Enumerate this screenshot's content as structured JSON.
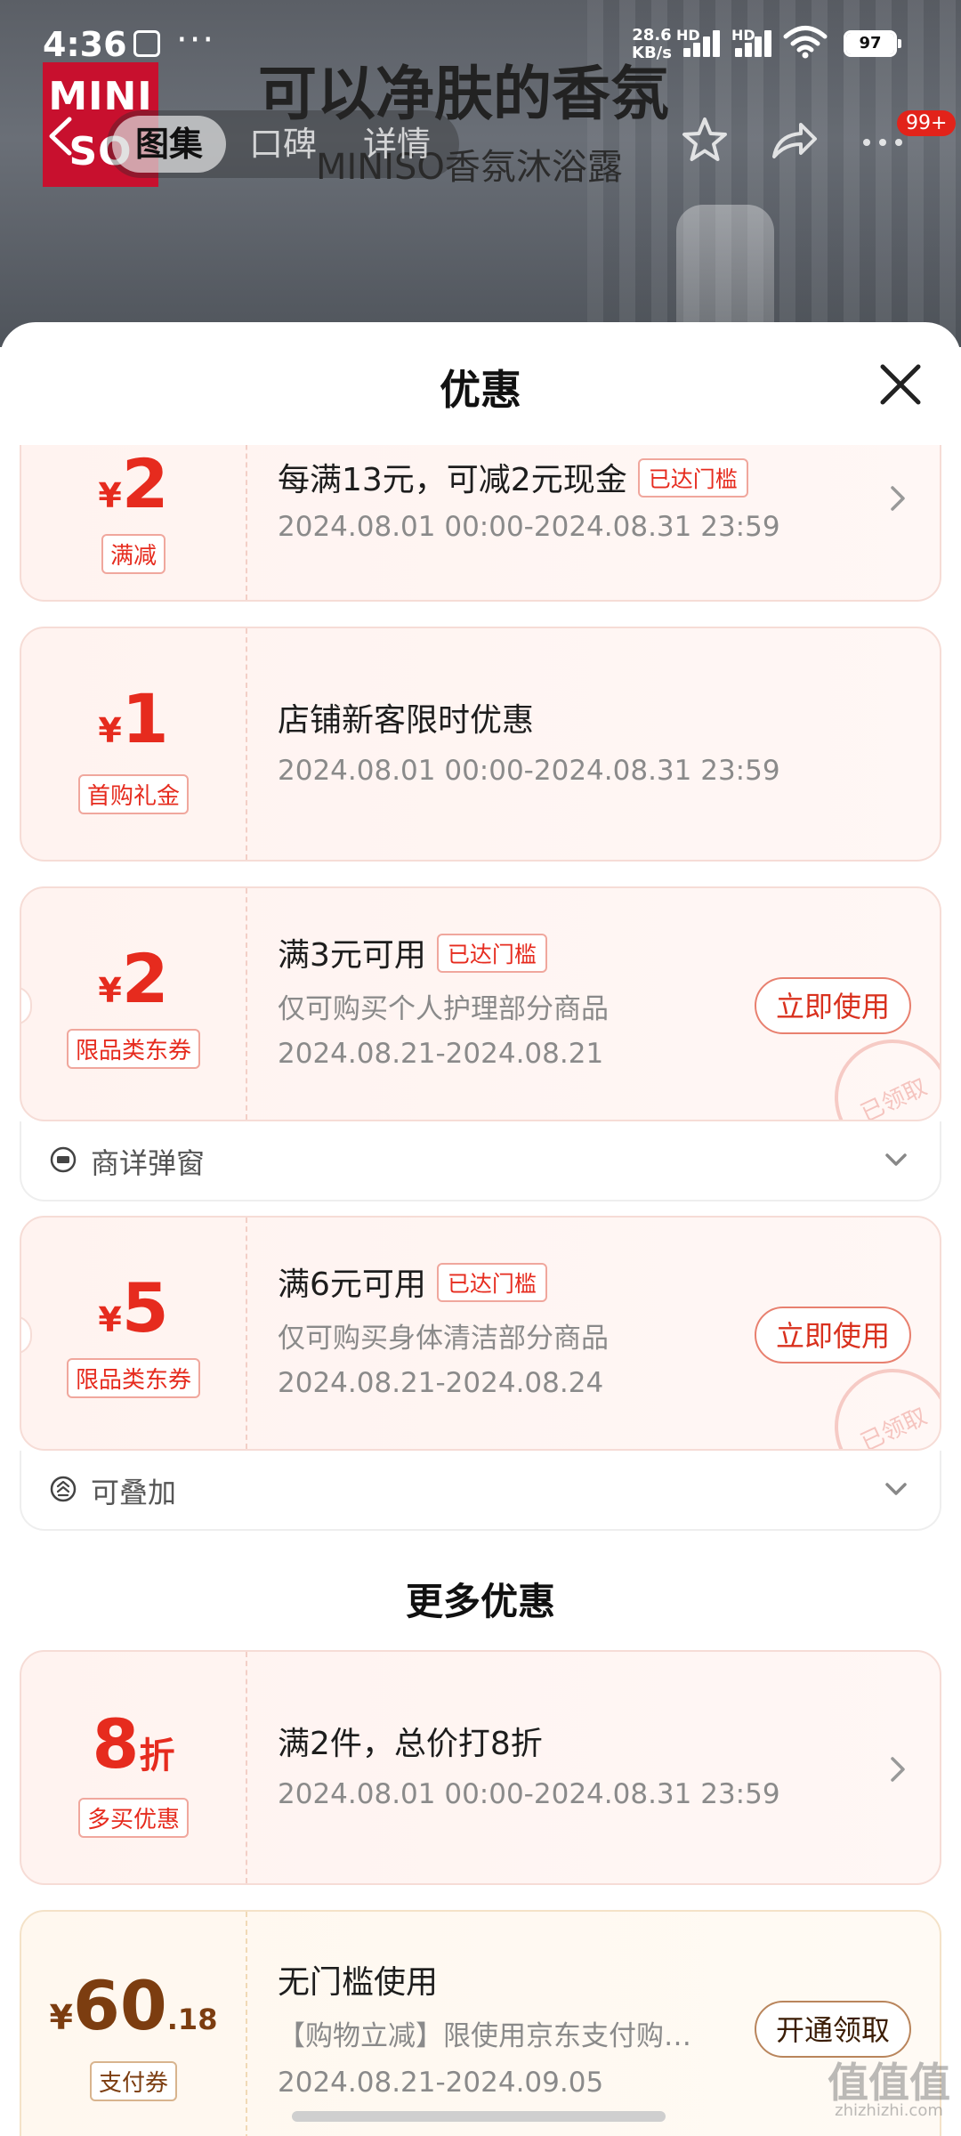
{
  "status_bar": {
    "time": "4:36",
    "dots": "···",
    "net_speed_value": "28.6",
    "net_speed_unit": "KB/s",
    "hd1": "HD",
    "hd2": "HD",
    "battery": "97"
  },
  "background": {
    "logo_text_1": "MINI",
    "logo_text_2": "SO",
    "title": "可以净肤的香氛",
    "subtitle": "MINISO香氛沐浴露"
  },
  "nav": {
    "tabs": [
      "图集",
      "口碑",
      "详情"
    ],
    "badge": "99+"
  },
  "sheet": {
    "title": "优惠"
  },
  "coupons": [
    {
      "currency": "¥",
      "amount": "2",
      "tag": "满减",
      "title": "每满13元，可减2元现金",
      "reached": "已达门槛",
      "date": "2024.08.01 00:00-2024.08.31 23:59"
    },
    {
      "currency": "¥",
      "amount": "1",
      "tag": "首购礼金",
      "title": "店铺新客限时优惠",
      "date": "2024.08.01 00:00-2024.08.31 23:59"
    },
    {
      "currency": "¥",
      "amount": "2",
      "tag": "限品类东券",
      "title": "满3元可用",
      "reached": "已达门槛",
      "desc": "仅可购买个人护理部分商品",
      "date": "2024.08.21-2024.08.21",
      "button": "立即使用",
      "stamp": "已领取",
      "extra": "商详弹窗"
    },
    {
      "currency": "¥",
      "amount": "5",
      "tag": "限品类东券",
      "title": "满6元可用",
      "reached": "已达门槛",
      "desc": "仅可购买身体清洁部分商品",
      "date": "2024.08.21-2024.08.24",
      "button": "立即使用",
      "stamp": "已领取",
      "extra": "可叠加"
    }
  ],
  "more_section": {
    "title": "更多优惠",
    "items": [
      {
        "amount": "8",
        "suffix": "折",
        "tag": "多买优惠",
        "title": "满2件，总价打8折",
        "date": "2024.08.01 00:00-2024.08.31 23:59"
      },
      {
        "currency": "¥",
        "amount": "60",
        "decimal": ".18",
        "tag": "支付券",
        "title": "无门槛使用",
        "desc": "【购物立减】限使用京东支付购…",
        "date": "2024.08.21-2024.09.05",
        "button": "开通领取"
      }
    ]
  },
  "watermark": {
    "main": "值值值",
    "sub": "zhizhizhi.com"
  },
  "colors": {
    "accent_red": "#e62b1e",
    "gold_text": "#7c3d10"
  }
}
